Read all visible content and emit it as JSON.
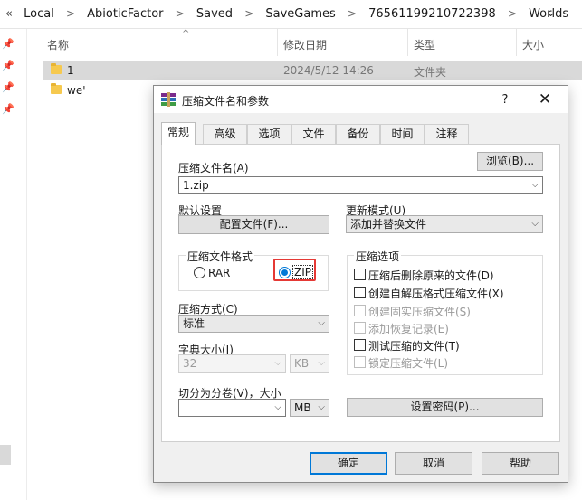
{
  "explorer": {
    "breadcrumb": [
      "Local",
      "AbioticFactor",
      "Saved",
      "SaveGames",
      "76561199210722398",
      "Worlds"
    ],
    "lead_glyph": "«",
    "columns": {
      "name": "名称",
      "modified": "修改日期",
      "type": "类型",
      "size": "大小"
    },
    "files": [
      {
        "name": "1",
        "modified": "2024/5/12 14:26",
        "type": "文件夹"
      },
      {
        "name": "we'",
        "modified": "",
        "type": ""
      }
    ]
  },
  "dialog": {
    "title": "压缩文件名和参数",
    "help": "?",
    "close": "✕",
    "tabs": [
      "常规",
      "高级",
      "选项",
      "文件",
      "备份",
      "时间",
      "注释"
    ],
    "archive_name_label": "压缩文件名(A)",
    "browse_button": "浏览(B)...",
    "archive_name_value": "1.zip",
    "default_settings_label": "默认设置",
    "profiles_button": "配置文件(F)...",
    "update_mode_label": "更新模式(U)",
    "update_mode_value": "添加并替换文件",
    "format_group": "压缩文件格式",
    "format_rar": "RAR",
    "format_zip": "ZIP",
    "format_selected": "ZIP",
    "method_label": "压缩方式(C)",
    "method_value": "标准",
    "dict_label": "字典大小(I)",
    "dict_value": "32",
    "dict_unit": "KB",
    "split_label": "切分为分卷(V)，大小",
    "split_value": "",
    "split_unit": "MB",
    "options_group": "压缩选项",
    "options": [
      {
        "label": "压缩后删除原来的文件(D)",
        "enabled": true,
        "checked": false
      },
      {
        "label": "创建自解压格式压缩文件(X)",
        "enabled": true,
        "checked": false
      },
      {
        "label": "创建固实压缩文件(S)",
        "enabled": false,
        "checked": false
      },
      {
        "label": "添加恢复记录(E)",
        "enabled": false,
        "checked": false
      },
      {
        "label": "测试压缩的文件(T)",
        "enabled": true,
        "checked": false
      },
      {
        "label": "锁定压缩文件(L)",
        "enabled": false,
        "checked": false
      }
    ],
    "password_button": "设置密码(P)...",
    "ok_button": "确定",
    "cancel_button": "取消",
    "help_button": "帮助"
  },
  "colors": {
    "accent": "#0078d7",
    "highlight": "#e53935"
  }
}
